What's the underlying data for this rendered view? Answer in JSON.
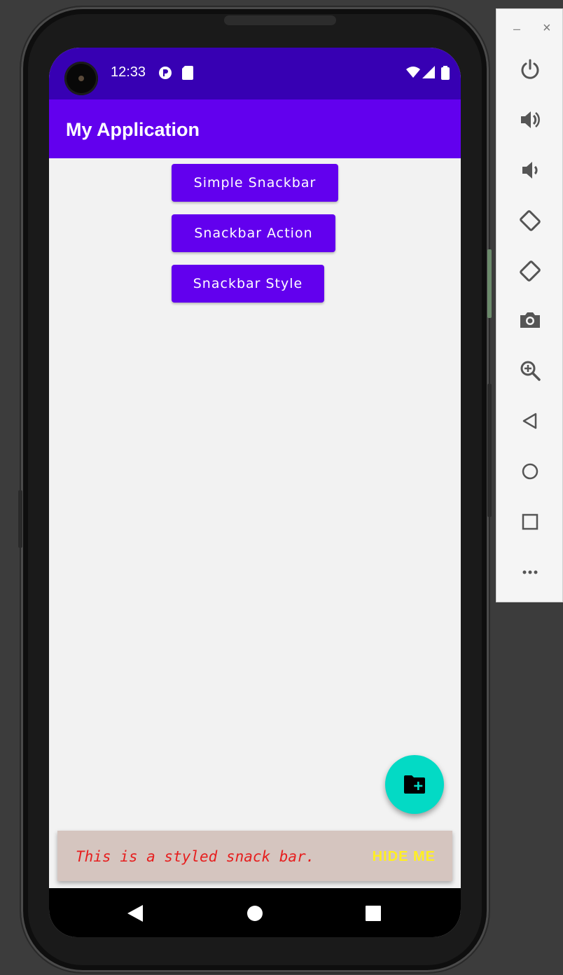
{
  "status_bar": {
    "time": "12:33",
    "left_icons": [
      "play-protect-icon",
      "sd-card-icon"
    ],
    "right_icons": [
      "wifi-icon",
      "signal-icon",
      "battery-icon"
    ]
  },
  "app_bar": {
    "title": "My Application"
  },
  "buttons": {
    "simple": "Simple Snackbar",
    "action": "Snackbar Action",
    "style": "Snackbar Style"
  },
  "fab": {
    "icon": "create-new-folder-icon"
  },
  "snackbar": {
    "message": "This is a styled snack bar.",
    "action": "HIDE ME",
    "message_color": "#e61e1e",
    "action_color": "#ffef22",
    "background": "#d5c5bf"
  },
  "nav_bar": {
    "icons": [
      "back-icon",
      "home-icon",
      "recents-icon"
    ]
  },
  "emulator_panel": {
    "minimize": "–",
    "close": "×",
    "tools": [
      "power-icon",
      "volume-up-icon",
      "volume-down-icon",
      "rotate-left-icon",
      "rotate-right-icon",
      "camera-icon",
      "zoom-icon",
      "back-icon",
      "home-icon",
      "overview-icon",
      "more-icon"
    ]
  },
  "colors": {
    "primary": "#6200ee",
    "primary_dark": "#3700b3",
    "accent": "#03dac5"
  }
}
